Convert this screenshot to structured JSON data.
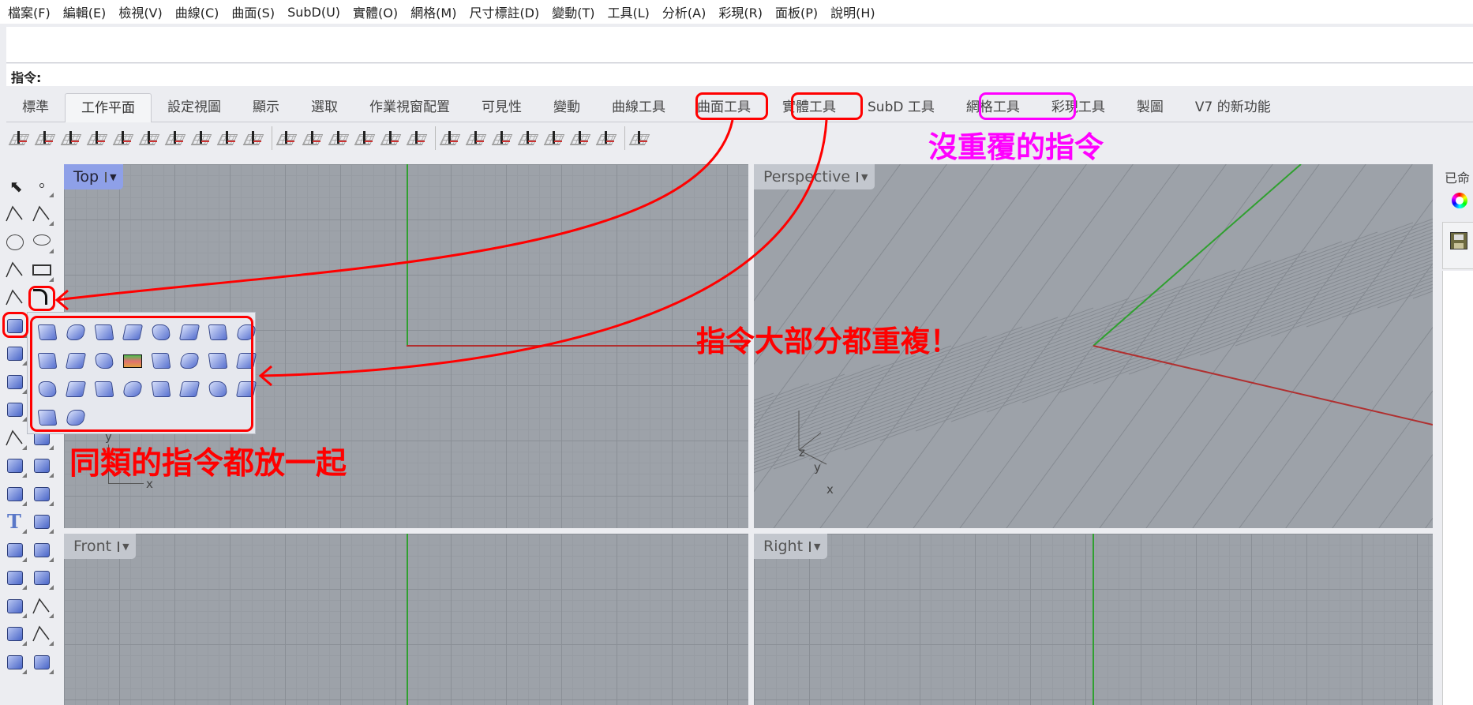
{
  "menu": [
    "檔案(F)",
    "編輯(E)",
    "檢視(V)",
    "曲線(C)",
    "曲面(S)",
    "SubD(U)",
    "實體(O)",
    "網格(M)",
    "尺寸標註(D)",
    "變動(T)",
    "工具(L)",
    "分析(A)",
    "彩現(R)",
    "面板(P)",
    "說明(H)"
  ],
  "command": {
    "label": "指令:",
    "value": ""
  },
  "tabs": [
    {
      "label": "標準"
    },
    {
      "label": "工作平面",
      "active": true
    },
    {
      "label": "設定視圖"
    },
    {
      "label": "顯示"
    },
    {
      "label": "選取"
    },
    {
      "label": "作業視窗配置"
    },
    {
      "label": "可見性"
    },
    {
      "label": "變動"
    },
    {
      "label": "曲線工具"
    },
    {
      "label": "曲面工具"
    },
    {
      "label": "實體工具"
    },
    {
      "label": "SubD 工具"
    },
    {
      "label": "網格工具"
    },
    {
      "label": "彩現工具"
    },
    {
      "label": "製圖"
    },
    {
      "label": "V7 的新功能"
    }
  ],
  "toolbar_icons": [
    "cplane-origin-icon",
    "cplane-elevation-icon",
    "cplane-object-icon",
    "cplane-surface-icon",
    "cplane-curve-icon",
    "cplane-3point-icon",
    "cplane-zaxis-icon",
    "cplane-xaxis-icon",
    "cplane-yaxis-icon",
    "cplane-vertical-icon",
    "|",
    "undo-cplane-icon",
    "cplane-select-icon",
    "cplane-grid-icon",
    "save-cplane-icon",
    "open-cplane-icon",
    "named-cplane-icon",
    "|",
    "cplane-to-view-icon",
    "cplane-top-icon",
    "cplane-bottom-icon",
    "cplane-front-icon",
    "cplane-back-icon",
    "cplane-left-icon",
    "cplane-right-icon",
    "|",
    "cplane-world-icon"
  ],
  "viewports": {
    "top": "Top",
    "perspective": "Perspective",
    "front": "Front",
    "right": "Right"
  },
  "axis_labels": {
    "x": "x",
    "y": "y",
    "z": "z"
  },
  "right_panel": {
    "title": "已命"
  },
  "annotations": {
    "grouped": "同類的指令都放一起",
    "duplicated": "指令大部分都重複！",
    "unique": "沒重覆的指令"
  },
  "colors": {
    "annotation_red": "#ff0000",
    "annotation_magenta": "#ff00ff",
    "active_viewport": "#8ea0e8",
    "x_axis": "#b03030",
    "y_axis": "#30a030"
  }
}
